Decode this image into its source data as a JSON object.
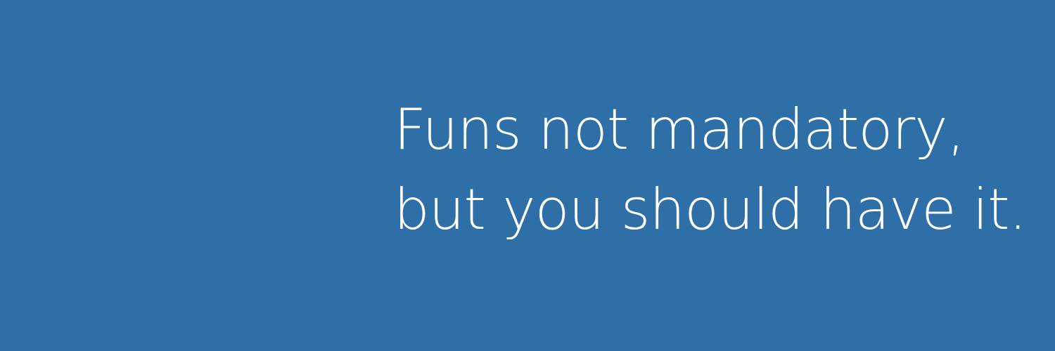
{
  "banner": {
    "background_color": "#2e6fa7",
    "text_color": "#ffffff",
    "quote": {
      "line1": "Funs not mandatory,",
      "line2": "but you should have it."
    }
  }
}
